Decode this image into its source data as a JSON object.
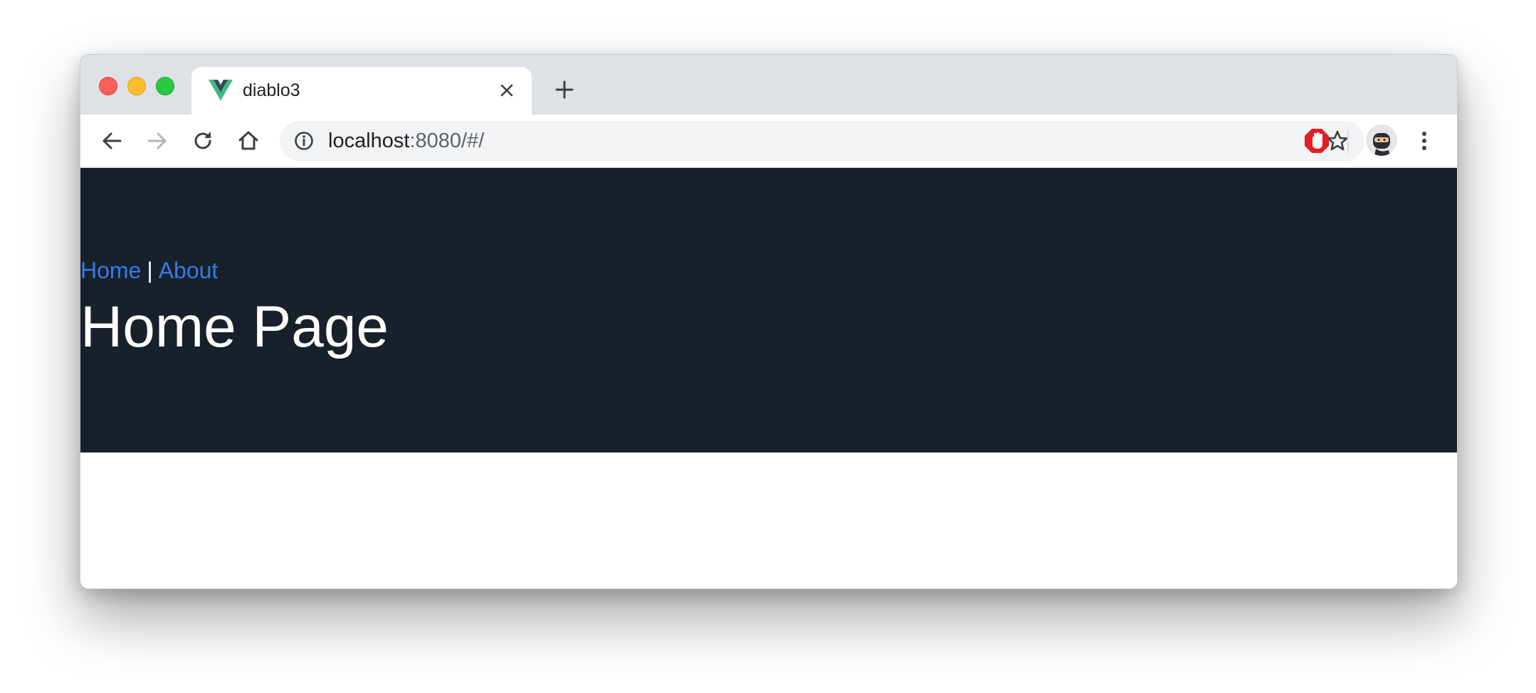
{
  "browser": {
    "tab": {
      "title": "diablo3",
      "favicon": "vue-logo-icon"
    },
    "address_bar": {
      "host": "localhost",
      "rest": ":8080/#/"
    },
    "colors": {
      "tabstrip": "#dee1e6",
      "omnibox": "#f1f3f4"
    }
  },
  "page": {
    "nav": {
      "links": [
        {
          "label": "Home"
        },
        {
          "label": "About"
        }
      ],
      "separator": "|"
    },
    "title": "Home Page",
    "colors": {
      "hero_background": "#18202c",
      "link": "#2f7ee8",
      "title": "#ffffff"
    }
  }
}
